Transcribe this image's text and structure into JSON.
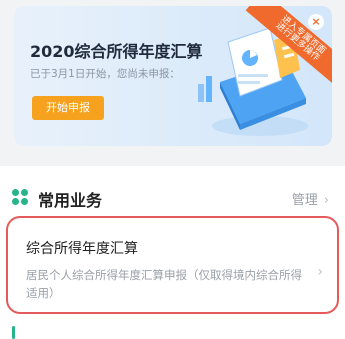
{
  "banner": {
    "title": "2020综合所得年度汇算",
    "subtitle": "已于3月1日开始，您尚未申报：",
    "button_label": "开始申报",
    "ribbon_line1": "进入专属页面",
    "ribbon_line2": "进行更多操作",
    "close_glyph": "×"
  },
  "section": {
    "title": "常用业务",
    "manage_label": "管理",
    "manage_chevron": "›"
  },
  "item": {
    "title": "综合所得年度汇算",
    "description": "居民个人综合所得年度汇算申报（仅取得境内综合所得适用）",
    "chevron": "›"
  },
  "colors": {
    "accent_orange": "#f6a21e",
    "ribbon_orange": "#ef6a2c",
    "brand_green": "#26b58b",
    "highlight_red": "#e55a5a"
  }
}
